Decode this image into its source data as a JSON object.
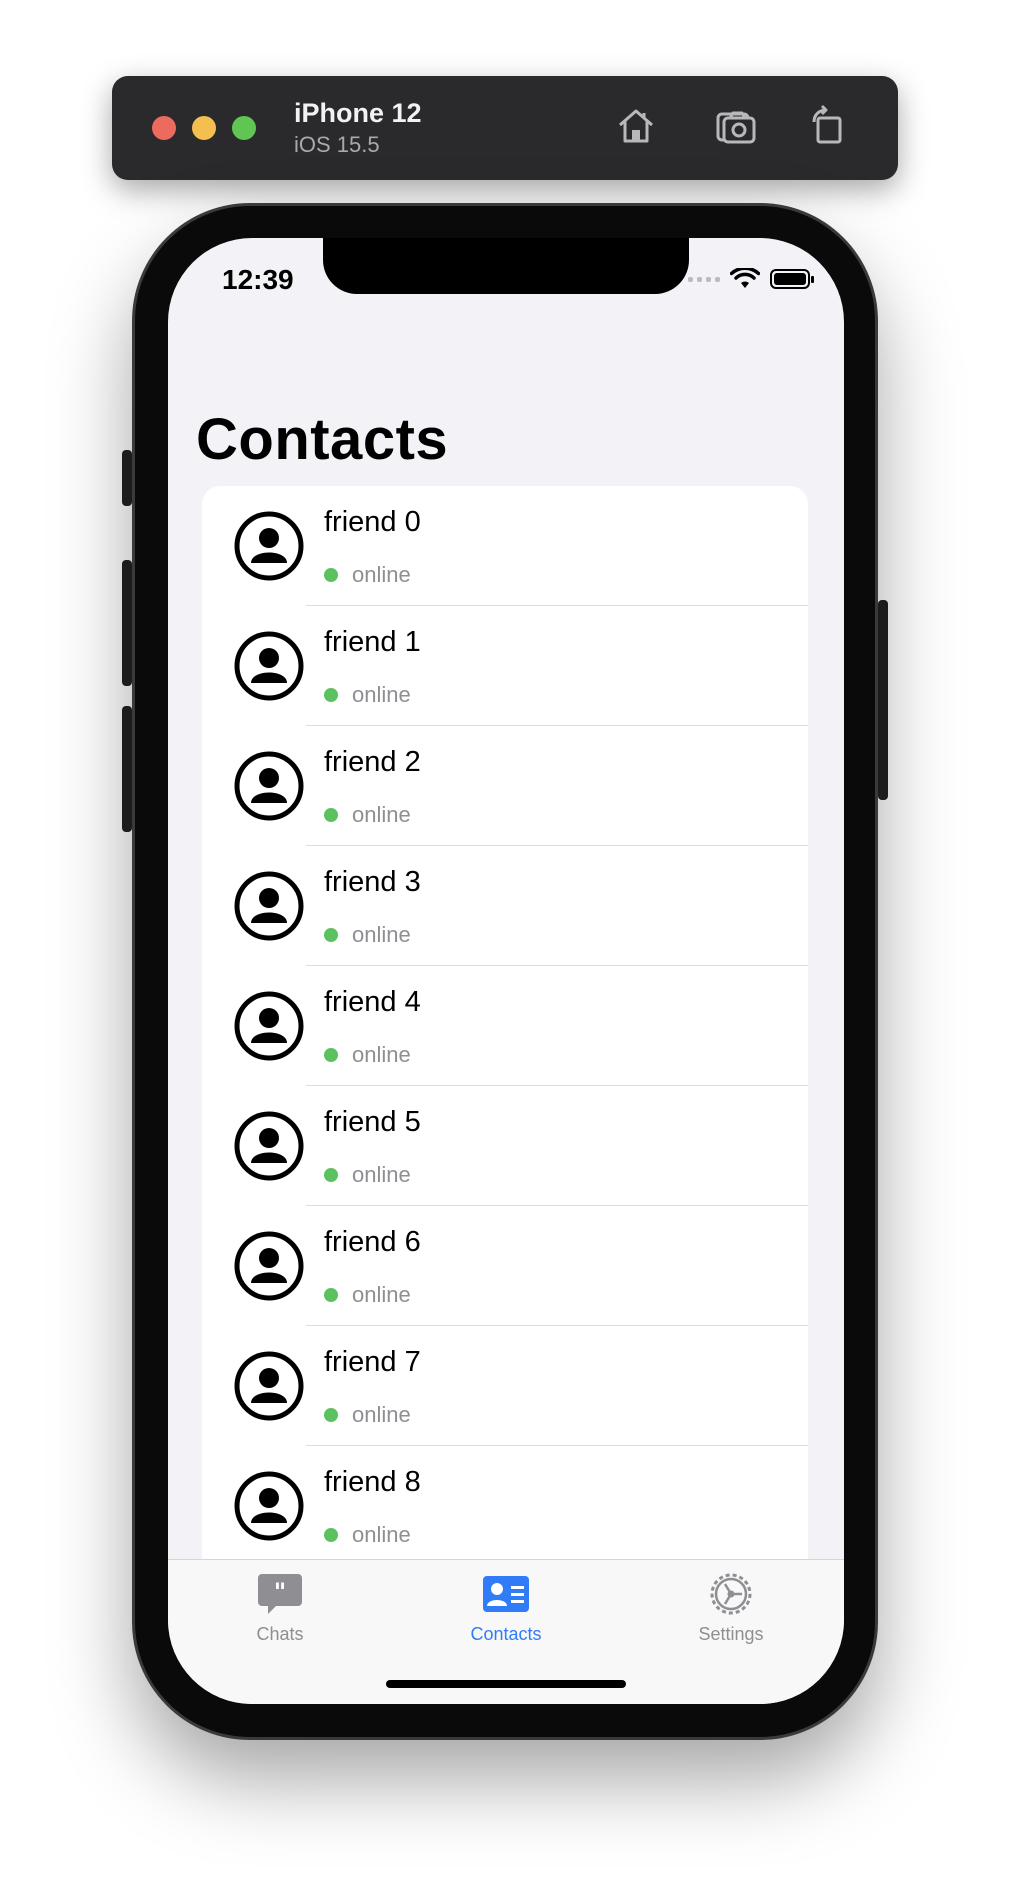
{
  "simulator": {
    "device": "iPhone 12",
    "os": "iOS 15.5",
    "buttons": [
      "home-icon",
      "screenshot-icon",
      "rotate-icon"
    ]
  },
  "status_bar": {
    "time": "12:39"
  },
  "page": {
    "title": "Contacts"
  },
  "contacts": [
    {
      "name": "friend 0",
      "status": "online"
    },
    {
      "name": "friend 1",
      "status": "online"
    },
    {
      "name": "friend 2",
      "status": "online"
    },
    {
      "name": "friend 3",
      "status": "online"
    },
    {
      "name": "friend 4",
      "status": "online"
    },
    {
      "name": "friend 5",
      "status": "online"
    },
    {
      "name": "friend 6",
      "status": "online"
    },
    {
      "name": "friend 7",
      "status": "online"
    },
    {
      "name": "friend 8",
      "status": "online"
    }
  ],
  "tabbar": {
    "tabs": [
      {
        "label": "Chats",
        "icon": "chat-bubble-icon",
        "selected": false
      },
      {
        "label": "Contacts",
        "icon": "contact-card-icon",
        "selected": true
      },
      {
        "label": "Settings",
        "icon": "gear-icon",
        "selected": false
      }
    ]
  },
  "colors": {
    "accent": "#2f7cf6",
    "online": "#5cc25f",
    "inactive_tab": "#8e8e93",
    "background": "#f2f2f7"
  }
}
